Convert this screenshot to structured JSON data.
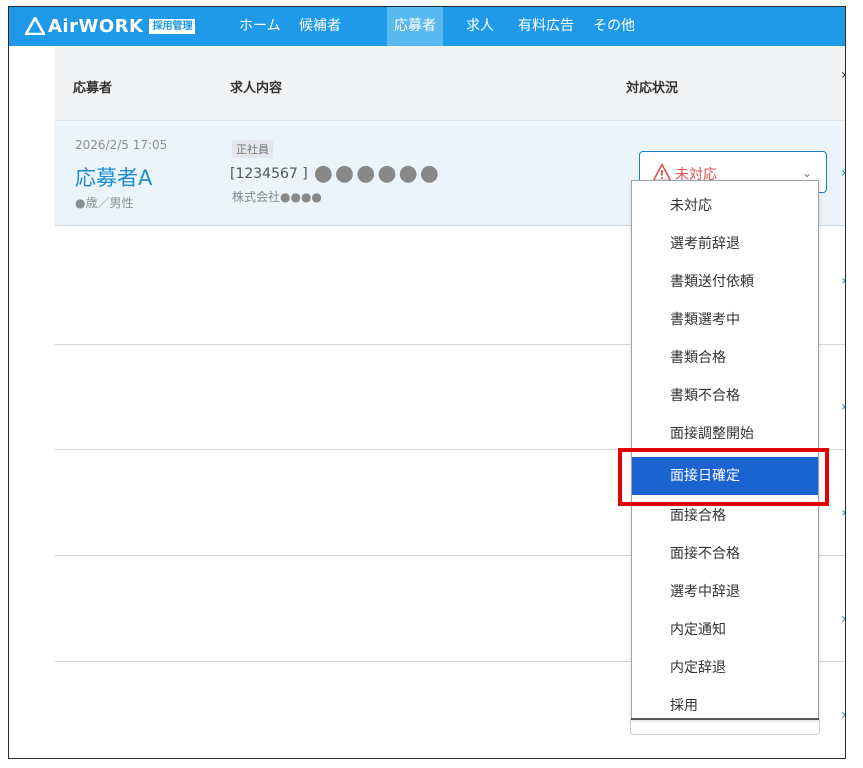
{
  "app": {
    "logo_text": "AirWORK",
    "logo_badge": "採用管理"
  },
  "nav": {
    "items": [
      {
        "label": "ホーム",
        "active": false
      },
      {
        "label": "候補者",
        "active": false
      },
      {
        "label": "応募者",
        "active": true
      },
      {
        "label": "求人",
        "active": false
      },
      {
        "label": "有料広告",
        "active": false
      },
      {
        "label": "その他",
        "active": false
      }
    ]
  },
  "table": {
    "headers": {
      "applicant": "応募者",
      "job": "求人内容",
      "status": "対応状況"
    },
    "row": {
      "datetime": "2026/2/5 17:05",
      "name": "応募者A",
      "age_gender": "●歳／男性",
      "employment_type": "正社員",
      "job_code": "[1234567 ]",
      "job_title": "●●●●●●",
      "company": "株式会社●●●●",
      "status": "未対応"
    }
  },
  "status_menu": {
    "options": [
      "未対応",
      "選考前辞退",
      "書類送付依頼",
      "書類選考中",
      "書類合格",
      "書類不合格",
      "面接調整開始",
      "面接日確定",
      "面接合格",
      "面接不合格",
      "選考中辞退",
      "内定通知",
      "内定辞退",
      "採用"
    ],
    "highlighted": "面接日確定"
  },
  "colors": {
    "nav_bg": "#1e9ae8",
    "nav_active": "#57b9f0",
    "warning": "#e05050",
    "selected_option": "#1a63d0",
    "callout": "#e30000"
  }
}
